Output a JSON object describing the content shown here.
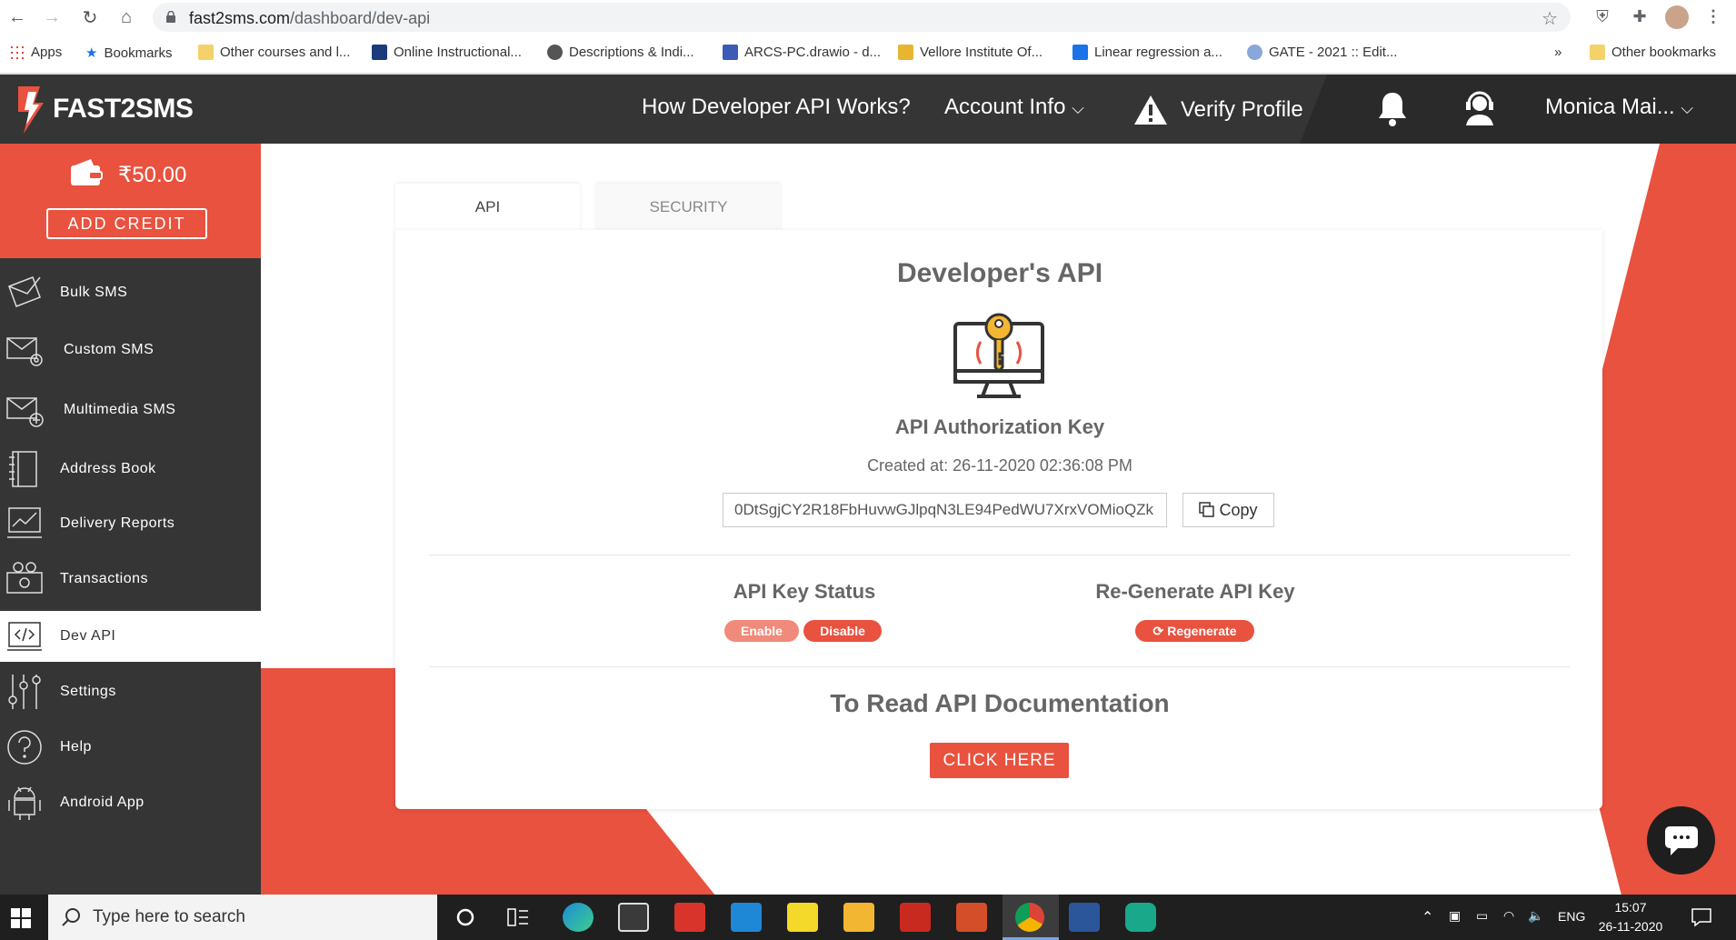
{
  "browser": {
    "url_host": "fast2sms.com",
    "url_path": "/dashboard/dev-api",
    "bookmarks": [
      "Apps",
      "Bookmarks",
      "Other courses and l...",
      "Online Instructional...",
      "Descriptions & Indi...",
      "ARCS-PC.drawio - d...",
      "Vellore Institute Of...",
      "Linear regression a...",
      "GATE - 2021 :: Edit..."
    ],
    "more": "»",
    "other_bookmarks": "Other bookmarks"
  },
  "header": {
    "logo": "FAST2SMS",
    "nav_how": "How Developer API Works?",
    "nav_account": "Account Info",
    "nav_verify": "Verify Profile",
    "user": "Monica Mai..."
  },
  "sidebar": {
    "balance": "₹50.00",
    "add_credit": "ADD CREDIT",
    "items": [
      {
        "label": "Bulk SMS",
        "icon": "envelope-icon"
      },
      {
        "label": "Custom SMS",
        "icon": "envelope-gear-icon"
      },
      {
        "label": "Multimedia SMS",
        "icon": "envelope-plus-icon"
      },
      {
        "label": "Address Book",
        "icon": "address-book-icon"
      },
      {
        "label": "Delivery Reports",
        "icon": "chart-icon"
      },
      {
        "label": "Transactions",
        "icon": "money-icon"
      },
      {
        "label": "Dev API",
        "icon": "code-icon"
      },
      {
        "label": "Settings",
        "icon": "sliders-icon"
      },
      {
        "label": "Help",
        "icon": "question-icon"
      },
      {
        "label": "Android App",
        "icon": "android-icon"
      }
    ]
  },
  "tabs": {
    "api": "API",
    "security": "SECURITY"
  },
  "card": {
    "title": "Developer's API",
    "key_title": "API Authorization Key",
    "created": "Created at: 26-11-2020 02:36:08 PM",
    "api_key": "0DtSgjCY2R18FbHuvwGJlpqN3LE94PedWU7XrxVOMioQZk",
    "copy": "Copy",
    "status_title": "API Key Status",
    "enable": "Enable",
    "disable": "Disable",
    "regen_title": "Re-Generate API Key",
    "regenerate": "Regenerate",
    "docs_title": "To Read API Documentation",
    "click_here": "CLICK HERE"
  },
  "taskbar": {
    "search": "Type here to search",
    "lang": "ENG",
    "time": "15:07",
    "date": "26-11-2020"
  },
  "colors": {
    "accent": "#e8523f",
    "dark": "#353535",
    "enable_pill": "#f08a7a"
  }
}
